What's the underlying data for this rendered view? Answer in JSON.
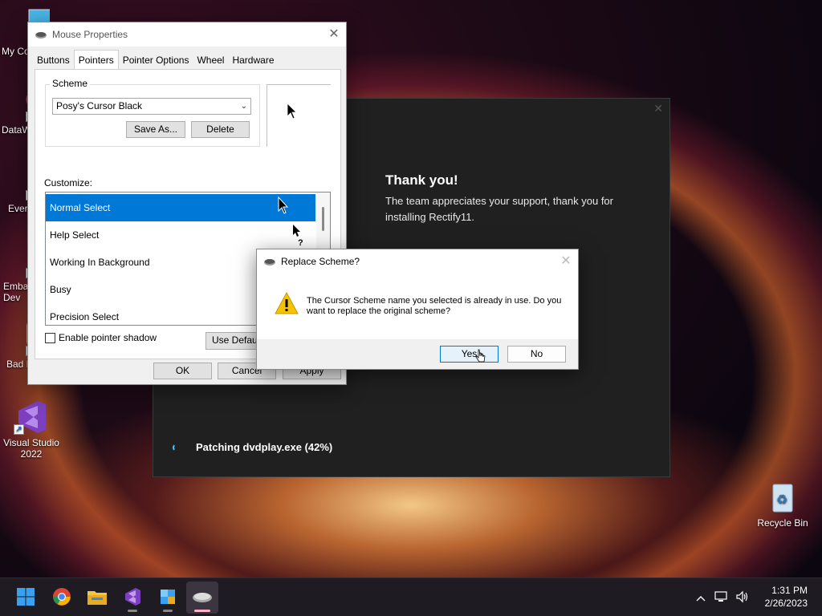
{
  "desktop": {
    "icons": [
      {
        "label": "My Co"
      },
      {
        "label": "DataW"
      },
      {
        "label": "Ever"
      },
      {
        "label": "Emba Dev"
      },
      {
        "label": "Bad P"
      },
      {
        "label": "Visual Studio 2022"
      },
      {
        "label": "Recycle Bin"
      }
    ]
  },
  "mouse_props": {
    "title": "Mouse Properties",
    "tabs": [
      "Buttons",
      "Pointers",
      "Pointer Options",
      "Wheel",
      "Hardware"
    ],
    "active_tab": "Pointers",
    "scheme_label": "Scheme",
    "scheme_value": "Posy's Cursor Black",
    "save_as_label": "Save As...",
    "delete_label": "Delete",
    "customize_label": "Customize:",
    "cursor_items": [
      {
        "label": "Normal Select",
        "selected": true
      },
      {
        "label": "Help Select",
        "selected": false
      },
      {
        "label": "Working In Background",
        "selected": false
      },
      {
        "label": "Busy",
        "selected": false
      },
      {
        "label": "Precision Select",
        "selected": false
      }
    ],
    "shadow_label": "Enable pointer shadow",
    "shadow_checked": false,
    "use_default_label": "Use Default",
    "ok_label": "OK",
    "cancel_label": "Cancel",
    "apply_label": "Apply"
  },
  "installer": {
    "heading": "Thank you!",
    "message": "The team appreciates your support, thank you for installing Rectify11.",
    "status": "Patching dvdplay.exe (42%)",
    "progress_percent": 42
  },
  "replace_dialog": {
    "title": "Replace Scheme?",
    "message": "The Cursor Scheme name you selected is already in use.  Do you want to replace the original scheme?",
    "yes_label": "Yes",
    "no_label": "No"
  },
  "taskbar": {
    "apps": [
      "start-icon",
      "chrome-icon",
      "file-explorer-icon",
      "visual-studio-icon",
      "rectify11-installer-icon",
      "mouse-properties-icon"
    ],
    "active_app": "mouse-properties-icon",
    "time": "1:31 PM",
    "date": "2/26/2023"
  },
  "colors": {
    "accent": "#0078d7",
    "installer_bg": "#202020",
    "taskbar_bg": "#1f1b22"
  }
}
